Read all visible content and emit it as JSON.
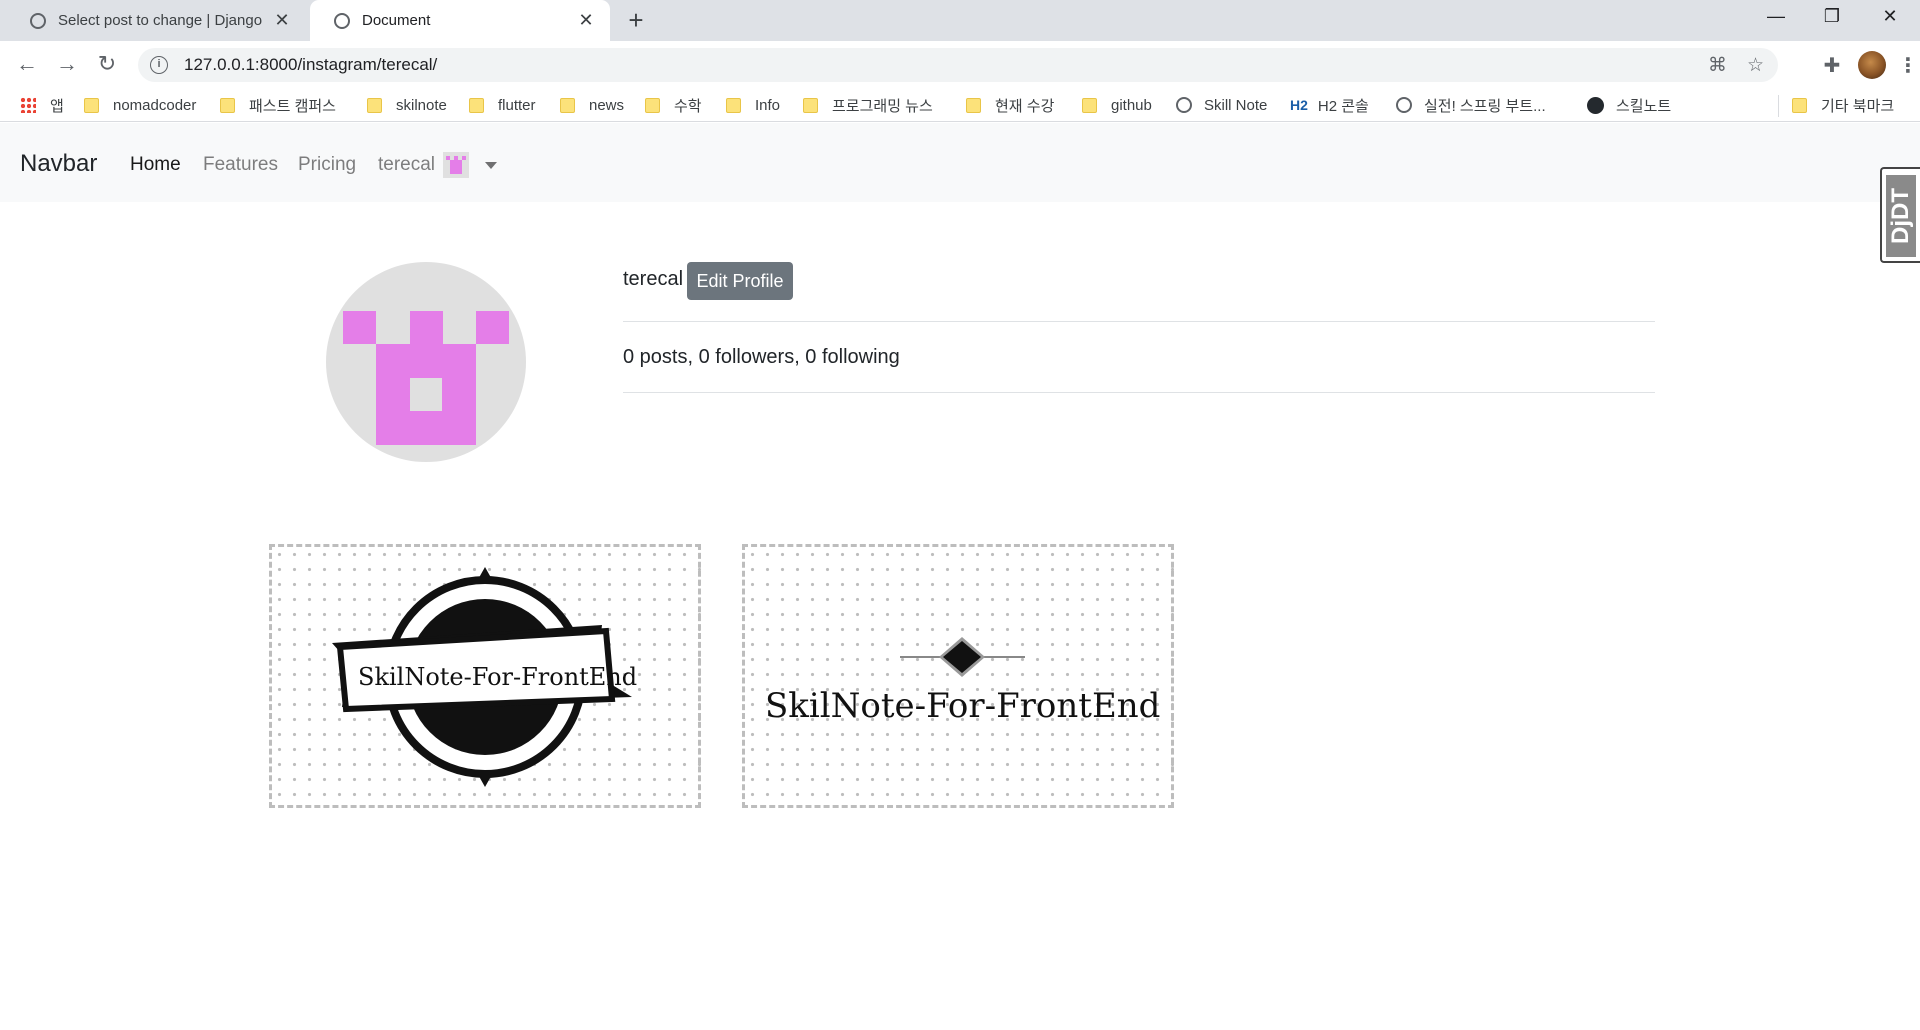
{
  "browser": {
    "tabs": [
      {
        "title": "Select post to change | Django",
        "active": false
      },
      {
        "title": "Document",
        "active": true
      }
    ],
    "url": "127.0.0.1:8000/instagram/terecal/",
    "bookmarks": [
      "앱",
      "nomadcoder",
      "패스트 캠퍼스",
      "skilnote",
      "flutter",
      "news",
      "수학",
      "Info",
      "프로그래밍 뉴스",
      "현재 수강",
      "github",
      "Skill Note",
      "H2 콘솔",
      "실전! 스프링 부트...",
      "스킬노트",
      "기타 북마크"
    ],
    "h2_badge": "H2"
  },
  "navbar": {
    "brand": "Navbar",
    "links": [
      "Home",
      "Features",
      "Pricing"
    ],
    "user": "terecal"
  },
  "side_widget": {
    "label": "DjDT"
  },
  "profile": {
    "username": "terecal",
    "edit_label": "Edit Profile",
    "stats": "0 posts, 0 followers, 0 following",
    "avatar_color": "#e47ee8"
  },
  "posts": [
    {
      "caption": "SkilNote-For-FrontEnd"
    },
    {
      "caption": "SkilNote-For-FrontEnd"
    }
  ]
}
